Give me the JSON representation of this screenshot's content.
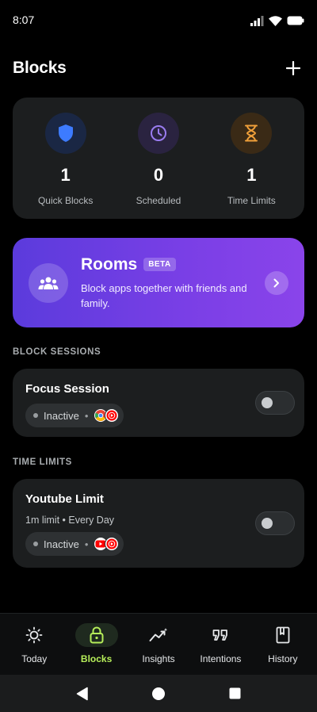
{
  "status_bar": {
    "time": "8:07"
  },
  "header": {
    "title": "Blocks",
    "add_label": "+"
  },
  "stats": [
    {
      "value": "1",
      "label": "Quick Blocks",
      "icon": "shield-icon",
      "color": "#3d7bff",
      "bg": "#1a2744"
    },
    {
      "value": "0",
      "label": "Scheduled",
      "icon": "clock-icon",
      "color": "#9a7cf0",
      "bg": "#2a2340"
    },
    {
      "value": "1",
      "label": "Time Limits",
      "icon": "hourglass-icon",
      "color": "#f0a03a",
      "bg": "#3a2a16"
    }
  ],
  "rooms": {
    "title": "Rooms",
    "badge": "BETA",
    "description": "Block apps together with friends and family.",
    "icon": "people-icon"
  },
  "sections": {
    "block_sessions": "BLOCK SESSIONS",
    "time_limits": "TIME LIMITS"
  },
  "focus_session": {
    "title": "Focus Session",
    "status": "Inactive",
    "separator": "•",
    "apps": [
      "chrome-icon",
      "youtube-music-icon"
    ]
  },
  "youtube_limit": {
    "title": "Youtube Limit",
    "subtitle": "1m limit • Every Day",
    "status": "Inactive",
    "separator": "•",
    "apps": [
      "youtube-icon",
      "youtube-music-icon"
    ]
  },
  "bottom_nav": {
    "items": [
      {
        "label": "Today",
        "icon": "sun-icon"
      },
      {
        "label": "Blocks",
        "icon": "lock-icon",
        "active": true
      },
      {
        "label": "Insights",
        "icon": "trend-icon"
      },
      {
        "label": "Intentions",
        "icon": "quote-icon"
      },
      {
        "label": "History",
        "icon": "book-icon"
      }
    ]
  },
  "colors": {
    "accent_green": "#b6ee5a",
    "card_bg": "#1c1e1f",
    "rooms_gradient_start": "#5b3bdc",
    "rooms_gradient_end": "#8a44ea"
  }
}
